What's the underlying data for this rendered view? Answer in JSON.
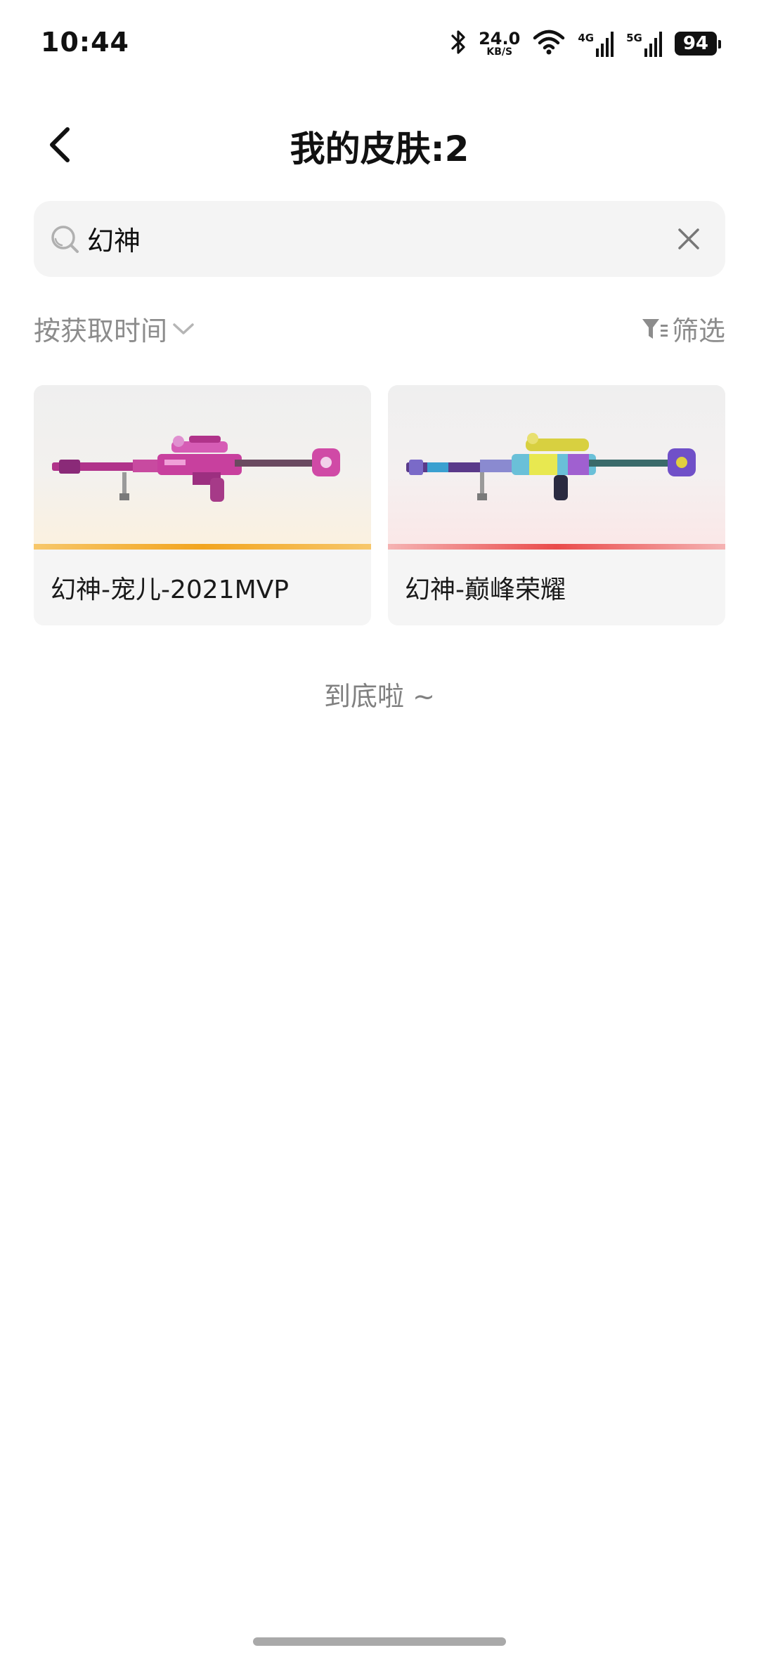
{
  "status_bar": {
    "time": "10:44",
    "net_speed_value": "24.0",
    "net_speed_unit": "KB/S",
    "signal1_label": "4G",
    "signal2_label": "5G",
    "battery": "94"
  },
  "header": {
    "title": "我的皮肤:2"
  },
  "search": {
    "query": "幻神"
  },
  "toolbar": {
    "sort_label": "按获取时间",
    "filter_label": "筛选"
  },
  "skins": [
    {
      "name": "幻神-宠儿-2021MVP",
      "rarity_color": "#f2a51f"
    },
    {
      "name": "幻神-巅峰荣耀",
      "rarity_color": "#ea4b4b"
    }
  ],
  "footer": {
    "end_text": "到底啦 ~"
  },
  "colors": {
    "muted_text": "#8c8c8c",
    "search_bg": "#f4f4f4",
    "card_bg": "#f5f5f5"
  }
}
